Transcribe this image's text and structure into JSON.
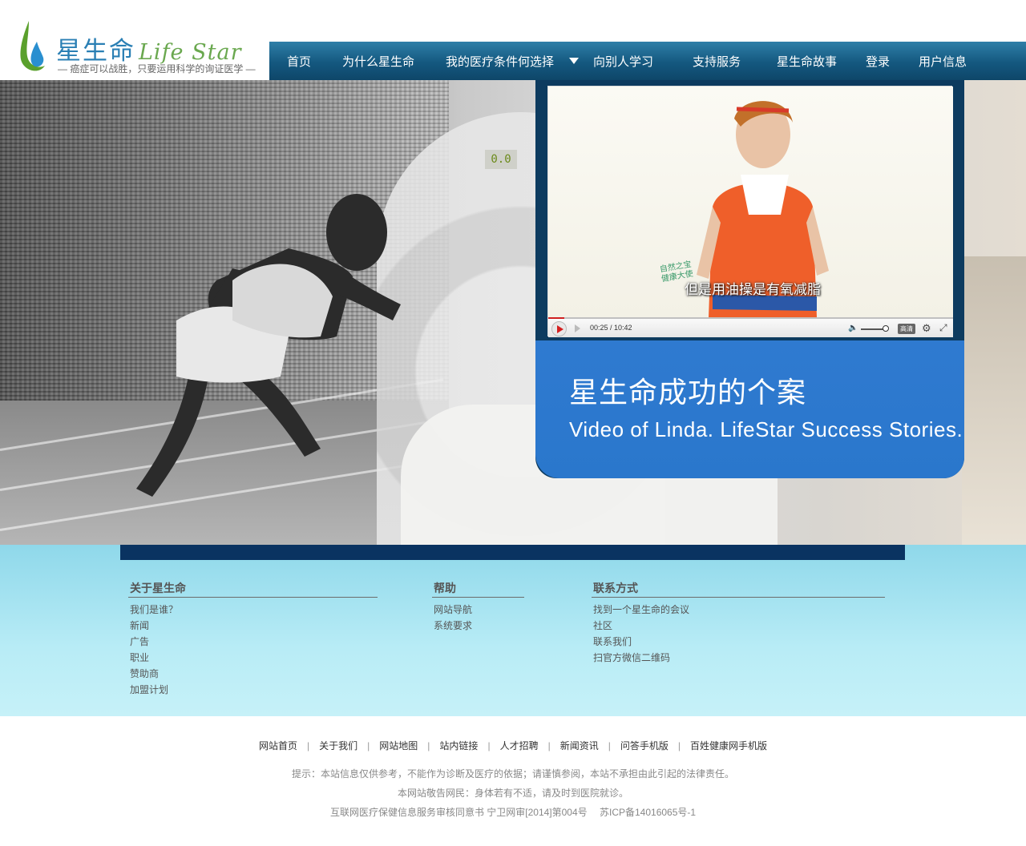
{
  "logo": {
    "title_cn": "星生命",
    "title_en": "Life Star",
    "slogan": "— 癌症可以战胜，只要运用科学的询证医学 —"
  },
  "nav": {
    "items": [
      "首页",
      "为什么星生命",
      "我的医疗条件何选择",
      "向别人学习",
      "支持服务",
      "星生命故事",
      "登录",
      "用户信息"
    ]
  },
  "hero": {
    "scanner_display": "0.0",
    "video": {
      "subtitle": "但是用油操是有氧减脂",
      "video_logo_line1": "自然之宝",
      "video_logo_line2": "健康大使",
      "time": "00:25 / 10:42",
      "quality": "高清",
      "progress": 0.04
    },
    "caption_cn": "星生命成功的个案",
    "caption_en": "Video of Linda. LifeStar Success Stories."
  },
  "footer": {
    "columns": [
      {
        "title": "关于星生命",
        "items": [
          "我们是谁？",
          "新闻",
          "广告",
          "职业",
          "赞助商",
          "加盟计划"
        ]
      },
      {
        "title": "帮助",
        "items": [
          "网站导航",
          "系统要求"
        ]
      },
      {
        "title": "联系方式",
        "items": [
          "找到一个星生命的会议",
          "社区",
          "联系我们",
          "扫官方微信二维码"
        ]
      }
    ],
    "bottom_links": [
      "网站首页",
      "关于我们",
      "网站地图",
      "站内链接",
      "人才招聘",
      "新闻资讯",
      "问答手机版",
      "百姓健康网手机版"
    ],
    "notice": "提示：本站信息仅供参考，不能作为诊断及医疗的依据；请谨慎参阅，本站不承担由此引起的法律责任。",
    "advice": "本网站敬告网民：身体若有不适，请及时到医院就诊。",
    "license": "互联网医疗保健信息服务审核同意书 宁卫网审[2014]第004号　 苏ICP备14016065号-1"
  },
  "colors": {
    "nav_bg": "#14587f",
    "caption_bg": "#2f7ad0",
    "footer_bar": "#0a3361",
    "footer_bg": "#b8ecf6"
  }
}
